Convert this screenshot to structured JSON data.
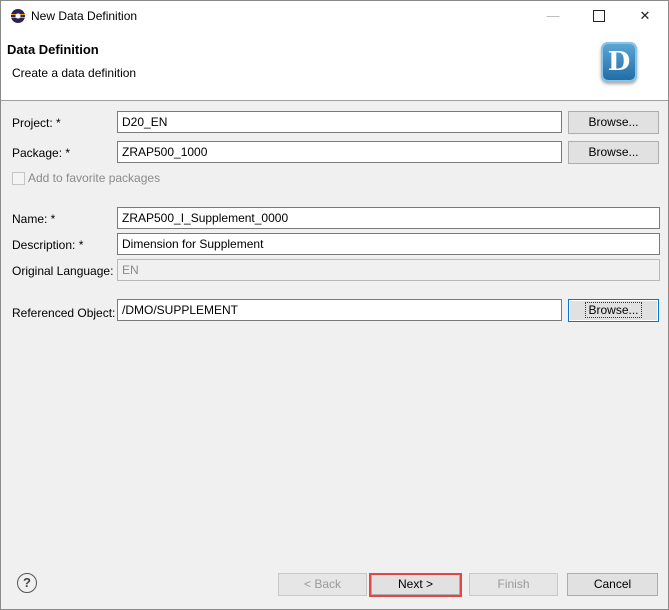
{
  "window": {
    "title": "New Data Definition"
  },
  "header": {
    "title": "Data Definition",
    "subtitle": "Create a data definition",
    "logo_letter": "D"
  },
  "form": {
    "project": {
      "label": "Project: *",
      "value": "D20_EN"
    },
    "package": {
      "label": "Package: *",
      "value": "ZRAP500_1000"
    },
    "favorite": {
      "label": "Add to favorite packages",
      "checked": false
    },
    "name": {
      "label": "Name: *",
      "value": "ZRAP500_I_Supplement_0000"
    },
    "description": {
      "label": "Description: *",
      "value": "Dimension for Supplement"
    },
    "language": {
      "label": "Original Language:",
      "value": "EN"
    },
    "referenced": {
      "label": "Referenced Object:",
      "value": "/DMO/SUPPLEMENT"
    },
    "browse_label": "Browse..."
  },
  "footer": {
    "help": "?",
    "back": "< Back",
    "next": "Next >",
    "finish": "Finish",
    "cancel": "Cancel"
  },
  "icons": {
    "window_minimize": "minimize-icon",
    "window_maximize": "maximize-icon",
    "window_close": "close-icon"
  }
}
